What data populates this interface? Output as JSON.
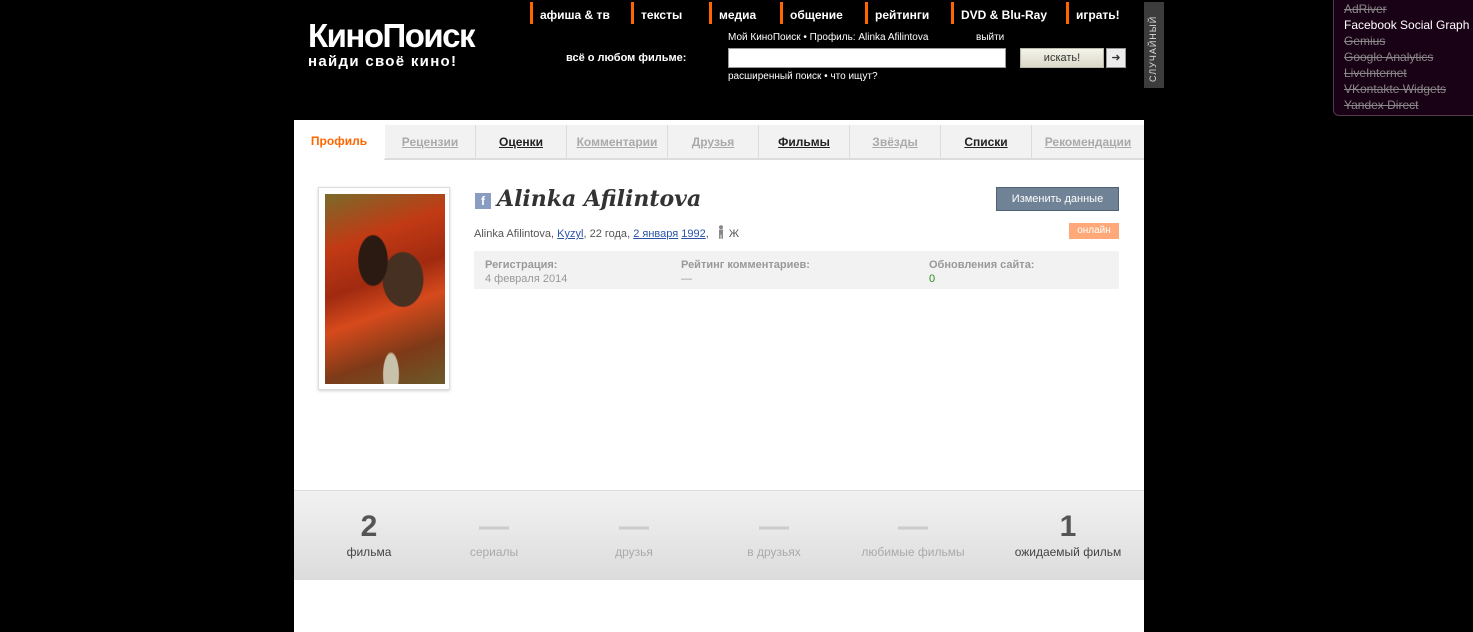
{
  "header": {
    "logo_title": "КиноПоиск",
    "logo_tagline": "найди своё кино!",
    "nav": [
      "афиша & тв",
      "тексты",
      "медиа",
      "общение",
      "рейтинги",
      "DVD & Blu-Ray",
      "играть!"
    ],
    "slogan": "всё о любом фильме:",
    "my_kinopoisk": "Мой КиноПоиск",
    "profile_link": "Профиль: Alinka Afilintova",
    "exit": "выйти",
    "search_value": "",
    "search_button": "искать!",
    "arrow_glyph": "➜",
    "advanced_search": "расширенный поиск",
    "who_searches": "что ищут?",
    "random": "СЛУЧАЙНЫЙ"
  },
  "tracker": {
    "items": [
      {
        "label": "AdRiver",
        "blocked": true
      },
      {
        "label": "Facebook Social Graph",
        "blocked": false
      },
      {
        "label": "Gemius",
        "blocked": true
      },
      {
        "label": "Google Analytics",
        "blocked": true
      },
      {
        "label": "LiveInternet",
        "blocked": true
      },
      {
        "label": "VKontakte Widgets",
        "blocked": true
      },
      {
        "label": "Yandex Direct",
        "blocked": true
      }
    ]
  },
  "tabs": [
    {
      "label": "Профиль",
      "state": "active"
    },
    {
      "label": "Рецензии",
      "state": "disabled"
    },
    {
      "label": "Оценки",
      "state": "normal"
    },
    {
      "label": "Комментарии",
      "state": "disabled"
    },
    {
      "label": "Друзья",
      "state": "disabled"
    },
    {
      "label": "Фильмы",
      "state": "normal"
    },
    {
      "label": "Звёзды",
      "state": "disabled"
    },
    {
      "label": "Списки",
      "state": "normal"
    },
    {
      "label": "Рекомендации",
      "state": "disabled"
    }
  ],
  "profile": {
    "fb_glyph": "f",
    "name": "Alinka Afilintova",
    "edit_button": "Изменить данные",
    "info_name": "Alinka Afilintova",
    "city": "Kyzyl",
    "age": "22 года",
    "birthday": "2 января",
    "year": "1992",
    "gender_icon": "person-icon",
    "gender": "Ж",
    "online": "онлайн",
    "stats": [
      {
        "label": "Регистрация:",
        "value": "4 февраля 2014"
      },
      {
        "label": "Рейтинг комментариев:",
        "value": "—"
      },
      {
        "label": "Обновления сайта:",
        "value": "0"
      }
    ]
  },
  "counts": [
    {
      "number": "2",
      "label": "фильма",
      "dim": false
    },
    {
      "number": "—",
      "label": "сериалы",
      "dim": true
    },
    {
      "number": "—",
      "label": "друзья",
      "dim": true
    },
    {
      "number": "—",
      "label": "в друзьях",
      "dim": true
    },
    {
      "number": "—",
      "label": "любимые фильмы",
      "dim": true
    },
    {
      "number": "1",
      "label": "ожидаемый фильм",
      "dim": false
    }
  ],
  "colors": {
    "accent": "#ff6600",
    "button": "#6f8296",
    "online": "#ffa97a"
  }
}
